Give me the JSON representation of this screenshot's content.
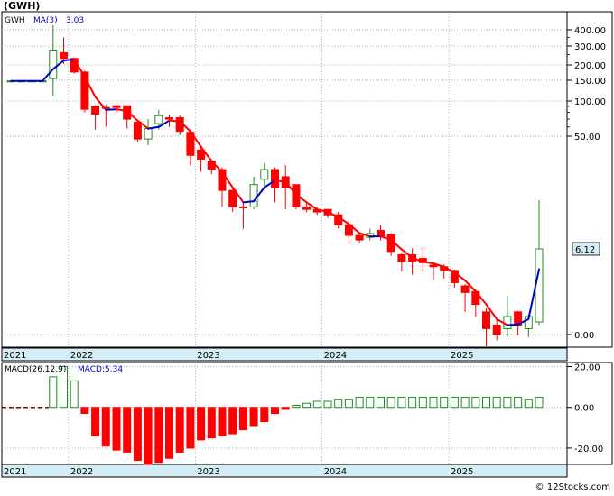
{
  "ticker_title": "(GWH)",
  "watermark": "© 12Stocks.com",
  "colors": {
    "up": "#228B22",
    "down": "#FF0000",
    "ma_up": "#0000CC",
    "ma_down": "#FF0000",
    "axis_band": "#D5EEF5",
    "price_tag": "#D5EEF5",
    "macd_up": "#228B22",
    "macd_down": "#FF0000"
  },
  "chart_data": [
    {
      "type": "candlestick",
      "name": "price",
      "legend": [
        "GWH",
        "MA(3)",
        "3.03"
      ],
      "scale": "log",
      "y_ticks": [
        0.0,
        50.0,
        100.0,
        150.0,
        200.0,
        300.0,
        400.0
      ],
      "y_tick_labels": [
        "0.00",
        "50.00",
        "100.00",
        "150.00",
        "200.00",
        "300.00",
        "400.00"
      ],
      "last_price_label": "6.12",
      "x_labels": [
        "2021",
        "2022",
        "2023",
        "2024",
        "2025"
      ],
      "x_label_month_index": [
        0,
        6,
        18,
        30,
        42
      ],
      "candles": [
        {
          "m": 0,
          "o": 148,
          "c": 148,
          "h": 148,
          "l": 148,
          "up": true
        },
        {
          "m": 1,
          "o": 148,
          "c": 148,
          "h": 148,
          "l": 148,
          "up": true
        },
        {
          "m": 2,
          "o": 148,
          "c": 148,
          "h": 148,
          "l": 148,
          "up": true
        },
        {
          "m": 3,
          "o": 148,
          "c": 148,
          "h": 148,
          "l": 148,
          "up": true
        },
        {
          "m": 4,
          "o": 155,
          "c": 275,
          "h": 430,
          "l": 110,
          "up": true
        },
        {
          "m": 5,
          "o": 260,
          "c": 230,
          "h": 350,
          "l": 205,
          "up": false
        },
        {
          "m": 6,
          "o": 230,
          "c": 175,
          "h": 235,
          "l": 170,
          "up": false
        },
        {
          "m": 7,
          "o": 175,
          "c": 85,
          "h": 180,
          "l": 80,
          "up": false
        },
        {
          "m": 8,
          "o": 90,
          "c": 77,
          "h": 92,
          "l": 57,
          "up": false
        },
        {
          "m": 9,
          "o": 88,
          "c": 88,
          "h": 93,
          "l": 60,
          "up": false
        },
        {
          "m": 10,
          "o": 91,
          "c": 88,
          "h": 92,
          "l": 80,
          "up": false
        },
        {
          "m": 11,
          "o": 91,
          "c": 70,
          "h": 92,
          "l": 58,
          "up": false
        },
        {
          "m": 12,
          "o": 66,
          "c": 48,
          "h": 66,
          "l": 46,
          "up": false
        },
        {
          "m": 13,
          "o": 48,
          "c": 58,
          "h": 70,
          "l": 44,
          "up": true
        },
        {
          "m": 14,
          "o": 64,
          "c": 75,
          "h": 84,
          "l": 57,
          "up": true
        },
        {
          "m": 15,
          "o": 70,
          "c": 72,
          "h": 76,
          "l": 60,
          "up": false
        },
        {
          "m": 16,
          "o": 72,
          "c": 55,
          "h": 75,
          "l": 51,
          "up": false
        },
        {
          "m": 17,
          "o": 54,
          "c": 38,
          "h": 57,
          "l": 33,
          "up": false
        },
        {
          "m": 18,
          "o": 41,
          "c": 36,
          "h": 43,
          "l": 30,
          "up": false
        },
        {
          "m": 19,
          "o": 35,
          "c": 31,
          "h": 36,
          "l": 29,
          "up": false
        },
        {
          "m": 20,
          "o": 31,
          "c": 23,
          "h": 32,
          "l": 17,
          "up": false
        },
        {
          "m": 21,
          "o": 23,
          "c": 17,
          "h": 24,
          "l": 15,
          "up": false
        },
        {
          "m": 22,
          "o": 17,
          "c": 17,
          "h": 19,
          "l": 10,
          "up": false
        },
        {
          "m": 23,
          "o": 17,
          "c": 25,
          "h": 28,
          "l": 16,
          "up": true
        },
        {
          "m": 24,
          "o": 27,
          "c": 31,
          "h": 34,
          "l": 24,
          "up": true
        },
        {
          "m": 25,
          "o": 31,
          "c": 24,
          "h": 32,
          "l": 19,
          "up": false
        },
        {
          "m": 26,
          "o": 28,
          "c": 24,
          "h": 33,
          "l": 16,
          "up": false
        },
        {
          "m": 27,
          "o": 25,
          "c": 17,
          "h": 25,
          "l": 16,
          "up": false
        },
        {
          "m": 28,
          "o": 17,
          "c": 16,
          "h": 19,
          "l": 15,
          "up": false
        },
        {
          "m": 29,
          "o": 16,
          "c": 15,
          "h": 17,
          "l": 14,
          "up": false
        },
        {
          "m": 30,
          "o": 16,
          "c": 14,
          "h": 16,
          "l": 13,
          "up": false
        },
        {
          "m": 31,
          "o": 14,
          "c": 11,
          "h": 15,
          "l": 10,
          "up": false
        },
        {
          "m": 32,
          "o": 11,
          "c": 8.5,
          "h": 12,
          "l": 6.9,
          "up": false
        },
        {
          "m": 33,
          "o": 8.5,
          "c": 7.6,
          "h": 9.0,
          "l": 7.0,
          "up": false
        },
        {
          "m": 34,
          "o": 8.1,
          "c": 8.9,
          "h": 10,
          "l": 7.5,
          "up": true
        },
        {
          "m": 35,
          "o": 9.6,
          "c": 8.3,
          "h": 11,
          "l": 7.5,
          "up": false
        },
        {
          "m": 36,
          "o": 8.6,
          "c": 5.6,
          "h": 9.0,
          "l": 4.8,
          "up": false
        },
        {
          "m": 37,
          "o": 5.0,
          "c": 4.0,
          "h": 5.4,
          "l": 2.8,
          "up": false
        },
        {
          "m": 38,
          "o": 5.0,
          "c": 4.0,
          "h": 6.2,
          "l": 2.5,
          "up": false
        },
        {
          "m": 39,
          "o": 4.4,
          "c": 3.8,
          "h": 6.4,
          "l": 2.8,
          "up": false
        },
        {
          "m": 40,
          "o": 3.5,
          "c": 3.3,
          "h": 3.9,
          "l": 2.1,
          "up": false
        },
        {
          "m": 41,
          "o": 3.3,
          "c": 2.9,
          "h": 3.6,
          "l": 2.2,
          "up": false
        },
        {
          "m": 42,
          "o": 2.9,
          "c": 1.9,
          "h": 3.0,
          "l": 1.6,
          "up": false
        },
        {
          "m": 43,
          "o": 1.7,
          "c": 1.35,
          "h": 1.8,
          "l": 0.7,
          "up": false
        },
        {
          "m": 44,
          "o": 1.4,
          "c": 0.9,
          "h": 1.5,
          "l": 0.6,
          "up": false
        },
        {
          "m": 45,
          "o": 0.7,
          "c": 0.4,
          "h": 0.8,
          "l": 0.02,
          "up": false
        },
        {
          "m": 46,
          "o": 0.45,
          "c": 0.33,
          "h": 0.55,
          "l": 0.12,
          "up": false
        },
        {
          "m": 47,
          "o": 0.4,
          "c": 0.6,
          "h": 1.2,
          "l": 0.3,
          "up": true
        },
        {
          "m": 48,
          "o": 0.7,
          "c": 0.45,
          "h": 0.72,
          "l": 0.32,
          "up": false
        },
        {
          "m": 49,
          "o": 0.4,
          "c": 0.6,
          "h": 0.65,
          "l": 0.3,
          "up": true
        },
        {
          "m": 50,
          "o": 0.5,
          "c": 6.12,
          "h": 20,
          "l": 0.45,
          "up": true
        }
      ],
      "ma": [
        {
          "m": 0,
          "v": 148,
          "up": true
        },
        {
          "m": 1,
          "v": 148,
          "up": true
        },
        {
          "m": 2,
          "v": 148,
          "up": true
        },
        {
          "m": 3,
          "v": 148,
          "up": true
        },
        {
          "m": 4,
          "v": 185,
          "up": true
        },
        {
          "m": 5,
          "v": 220,
          "up": true
        },
        {
          "m": 6,
          "v": 225,
          "up": true
        },
        {
          "m": 7,
          "v": 160,
          "up": false
        },
        {
          "m": 8,
          "v": 108,
          "up": false
        },
        {
          "m": 9,
          "v": 84,
          "up": false
        },
        {
          "m": 10,
          "v": 85,
          "up": true
        },
        {
          "m": 11,
          "v": 82,
          "up": false
        },
        {
          "m": 12,
          "v": 68,
          "up": false
        },
        {
          "m": 13,
          "v": 58,
          "up": false
        },
        {
          "m": 14,
          "v": 60,
          "up": true
        },
        {
          "m": 15,
          "v": 68,
          "up": true
        },
        {
          "m": 16,
          "v": 67,
          "up": false
        },
        {
          "m": 17,
          "v": 55,
          "up": false
        },
        {
          "m": 18,
          "v": 43,
          "up": false
        },
        {
          "m": 19,
          "v": 35,
          "up": false
        },
        {
          "m": 20,
          "v": 30,
          "up": false
        },
        {
          "m": 21,
          "v": 24,
          "up": false
        },
        {
          "m": 22,
          "v": 19,
          "up": false
        },
        {
          "m": 23,
          "v": 19.5,
          "up": true
        },
        {
          "m": 24,
          "v": 24,
          "up": true
        },
        {
          "m": 25,
          "v": 26.5,
          "up": true
        },
        {
          "m": 26,
          "v": 26,
          "up": false
        },
        {
          "m": 27,
          "v": 21.7,
          "up": false
        },
        {
          "m": 28,
          "v": 19,
          "up": false
        },
        {
          "m": 29,
          "v": 16,
          "up": false
        },
        {
          "m": 30,
          "v": 15,
          "up": false
        },
        {
          "m": 31,
          "v": 13.3,
          "up": false
        },
        {
          "m": 32,
          "v": 11.2,
          "up": false
        },
        {
          "m": 33,
          "v": 9,
          "up": false
        },
        {
          "m": 34,
          "v": 8.3,
          "up": false
        },
        {
          "m": 35,
          "v": 8.3,
          "up": true
        },
        {
          "m": 36,
          "v": 7.6,
          "up": false
        },
        {
          "m": 37,
          "v": 6.0,
          "up": false
        },
        {
          "m": 38,
          "v": 4.5,
          "up": false
        },
        {
          "m": 39,
          "v": 3.9,
          "up": false
        },
        {
          "m": 40,
          "v": 3.7,
          "up": false
        },
        {
          "m": 41,
          "v": 3.3,
          "up": false
        },
        {
          "m": 42,
          "v": 2.7,
          "up": false
        },
        {
          "m": 43,
          "v": 2.05,
          "up": false
        },
        {
          "m": 44,
          "v": 1.4,
          "up": false
        },
        {
          "m": 45,
          "v": 0.9,
          "up": false
        },
        {
          "m": 46,
          "v": 0.55,
          "up": false
        },
        {
          "m": 47,
          "v": 0.45,
          "up": false
        },
        {
          "m": 48,
          "v": 0.46,
          "up": true
        },
        {
          "m": 49,
          "v": 0.55,
          "up": true
        },
        {
          "m": 50,
          "v": 3.03,
          "up": true
        }
      ]
    },
    {
      "type": "bar",
      "name": "macd",
      "legend": [
        "MACD(26,12,9)",
        "MACD:5.34"
      ],
      "y_ticks": [
        20,
        0,
        -20
      ],
      "y_tick_labels": [
        "20.00",
        "0.00",
        "-20.00"
      ],
      "ylim": [
        -28,
        22
      ],
      "x_labels": [
        "2021",
        "2022",
        "2023",
        "2024",
        "2025"
      ],
      "values": [
        0,
        0,
        0,
        0,
        15,
        20,
        13,
        -3,
        -14,
        -19,
        -21,
        -22,
        -26,
        -28,
        -27,
        -25,
        -22,
        -20,
        -16,
        -15,
        -14,
        -13,
        -11,
        -9,
        -7,
        -3,
        -1,
        1,
        2,
        3,
        3,
        4,
        4,
        5,
        5,
        5,
        5,
        5,
        5,
        5,
        5,
        5,
        5,
        5,
        5,
        5,
        5,
        5,
        5,
        4,
        5
      ],
      "signal_dashed_until": 4
    }
  ]
}
